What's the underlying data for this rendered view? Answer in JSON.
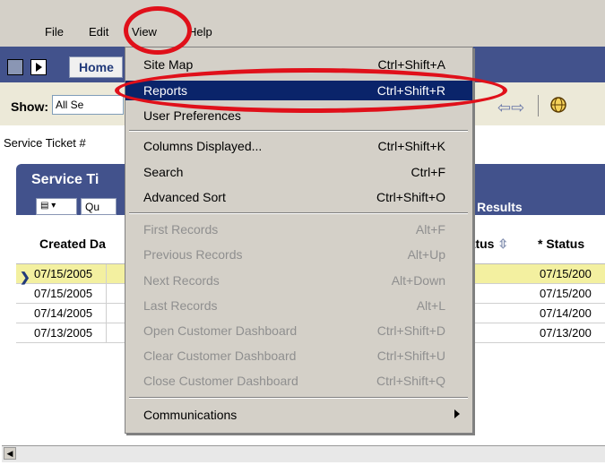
{
  "menubar": {
    "file": "File",
    "edit": "Edit",
    "view": "View",
    "help": "Help"
  },
  "header": {
    "home_tab": "Home"
  },
  "toolbar": {
    "show_label": "Show:",
    "show_value": "All Se"
  },
  "filter_label": "Service Ticket #",
  "panel": {
    "title": "Service Ti",
    "tool_label": "Qu",
    "results_label": "ry Results",
    "columns": {
      "created": "Created Da",
      "status_partial": "tatus",
      "status": "* Status"
    },
    "rows": [
      {
        "created": "07/15/2005",
        "status_date": "07/15/200",
        "selected": true
      },
      {
        "created": "07/15/2005",
        "status_date": "07/15/200",
        "selected": false
      },
      {
        "created": "07/14/2005",
        "status_date": "07/14/200",
        "selected": false
      },
      {
        "created": "07/13/2005",
        "status_date": "07/13/200",
        "selected": false
      }
    ]
  },
  "view_menu": {
    "items": [
      {
        "label": "Site Map",
        "shortcut": "Ctrl+Shift+A"
      },
      {
        "label": "Reports",
        "shortcut": "Ctrl+Shift+R"
      },
      {
        "label": "User Preferences",
        "shortcut": ""
      },
      {
        "label": "Columns Displayed...",
        "shortcut": "Ctrl+Shift+K"
      },
      {
        "label": "Search",
        "shortcut": "Ctrl+F"
      },
      {
        "label": "Advanced Sort",
        "shortcut": "Ctrl+Shift+O"
      },
      {
        "label": "First Records",
        "shortcut": "Alt+F"
      },
      {
        "label": "Previous Records",
        "shortcut": "Alt+Up"
      },
      {
        "label": "Next Records",
        "shortcut": "Alt+Down"
      },
      {
        "label": "Last Records",
        "shortcut": "Alt+L"
      },
      {
        "label": "Open Customer Dashboard",
        "shortcut": "Ctrl+Shift+D"
      },
      {
        "label": "Clear Customer Dashboard",
        "shortcut": "Ctrl+Shift+U"
      },
      {
        "label": "Close Customer Dashboard",
        "shortcut": "Ctrl+Shift+Q"
      },
      {
        "label": "Communications",
        "shortcut": ""
      }
    ]
  },
  "colors": {
    "menu_bg": "#d4d0c8",
    "highlight": "#0a246a",
    "header_blue": "#42528c",
    "annotation": "#e0101a"
  }
}
